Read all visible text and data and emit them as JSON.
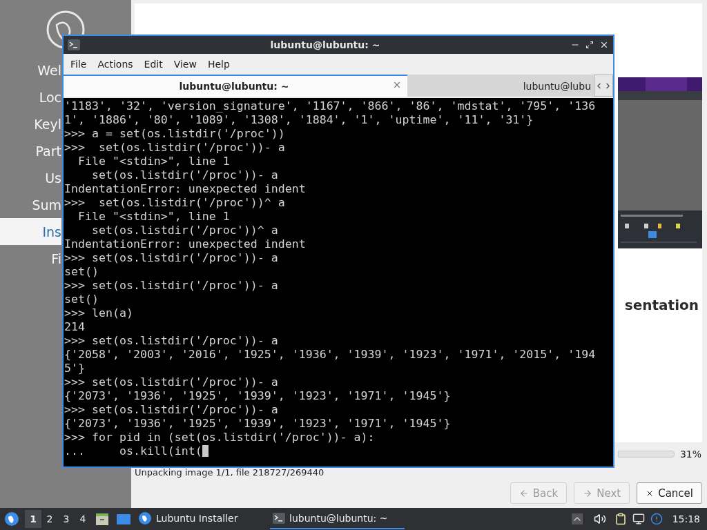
{
  "installer": {
    "sidebar": [
      {
        "label": "Wel",
        "selected": false
      },
      {
        "label": "Loc",
        "selected": false
      },
      {
        "label": "Keyl",
        "selected": false
      },
      {
        "label": "Part",
        "selected": false
      },
      {
        "label": "Us",
        "selected": false
      },
      {
        "label": "Sum",
        "selected": false
      },
      {
        "label": "Ins",
        "selected": true
      },
      {
        "label": "Fi",
        "selected": false
      }
    ],
    "slide": {
      "kind": "picture",
      "heading": "sentation"
    },
    "progress": {
      "reading": "31%"
    },
    "status": "Unpacking image 1/1, file 218727/269440",
    "buttons": [
      {
        "kind": "back",
        "label": "Back",
        "disabled": true
      },
      {
        "kind": "next",
        "label": "Next",
        "disabled": true
      },
      {
        "kind": "cancel",
        "label": "Cancel",
        "disabled": false
      }
    ]
  },
  "terminal": {
    "title": "lubuntu@lubuntu: ~",
    "menu": [
      "File",
      "Actions",
      "Edit",
      "View",
      "Help"
    ],
    "tabs": [
      {
        "label": "lubuntu@lubuntu: ~",
        "selected": true
      },
      {
        "label": "lubuntu@lubu",
        "selected": false
      }
    ],
    "lines": [
      "'1183', '32', 'version_signature', '1167', '866', '86', 'mdstat', '795', '136",
      "1', '1886', '80', '1089', '1308', '1884', '1', 'uptime', '11', '31'}",
      ">>> a = set(os.listdir('/proc'))",
      ">>>  set(os.listdir('/proc'))- a",
      "  File \"<stdin>\", line 1",
      "    set(os.listdir('/proc'))- a",
      "IndentationError: unexpected indent",
      ">>>  set(os.listdir('/proc'))^ a",
      "  File \"<stdin>\", line 1",
      "    set(os.listdir('/proc'))^ a",
      "IndentationError: unexpected indent",
      ">>> set(os.listdir('/proc'))- a",
      "set()",
      ">>> set(os.listdir('/proc'))- a",
      "set()",
      ">>> len(a)",
      "214",
      ">>> set(os.listdir('/proc'))- a",
      "{'2058', '2003', '2016', '1925', '1936', '1939', '1923', '1971', '2015', '194",
      "5'}",
      ">>> set(os.listdir('/proc'))- a",
      "{'2073', '1936', '1925', '1939', '1923', '1971', '1945'}",
      ">>> set(os.listdir('/proc'))- a",
      "{'2073', '1936', '1925', '1939', '1923', '1971', '1945'}",
      ">>> for pid in (set(os.listdir('/proc'))- a):",
      "...     os.kill(int("
    ]
  },
  "taskbar": {
    "workspaces": [
      {
        "label": "1",
        "selected": true
      },
      {
        "label": "2",
        "selected": false
      },
      {
        "label": "3",
        "selected": false
      },
      {
        "label": "4",
        "selected": false
      }
    ],
    "tasks": [
      {
        "kind": "installer",
        "label": "Lubuntu Installer",
        "selected": false
      },
      {
        "kind": "terminal",
        "label": "lubuntu@lubuntu: ~",
        "selected": true
      }
    ],
    "clock": "15:18"
  }
}
